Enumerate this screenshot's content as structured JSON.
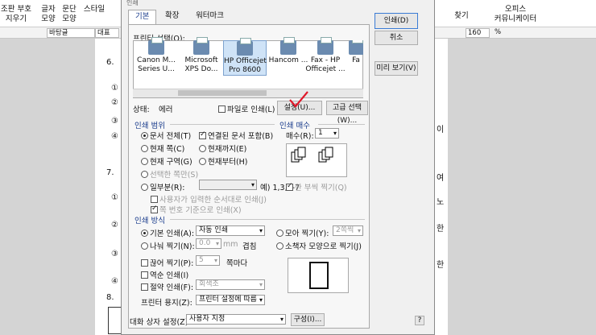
{
  "ribbon": {
    "items": [
      {
        "label": "조판 부호\n지우기"
      },
      {
        "label": "글자\n모양"
      },
      {
        "label": "문단\n모양"
      },
      {
        "label": "스타일"
      },
      {
        "label": "찾기"
      },
      {
        "label": "오피스\n커뮤니케이터"
      }
    ]
  },
  "toolbar": {
    "style_value": "바탕글",
    "font_value": "대표",
    "zoom_value": "160",
    "zoom_unit": "%"
  },
  "document": {
    "lines": [
      "6.",
      "①",
      "②",
      "③",
      "④",
      "7.",
      "①",
      "②",
      "③",
      "④",
      "8.",
      "이",
      "여",
      "노",
      "한",
      "한"
    ]
  },
  "dialog": {
    "title": "인쇄",
    "tabs": [
      "기본",
      "확장",
      "워터마크"
    ],
    "printer_select_label": "프린터 선택(O):",
    "printers": [
      "Canon M...\nSeries U...",
      "Microsoft\nXPS Do...",
      "HP Officejet\nPro 8600",
      "Hancom ...",
      "Fax - HP\nOfficejet ...",
      "Fa"
    ],
    "status_label": "상태:",
    "status_value": "에러",
    "print_to_file": "파일로 인쇄(L)",
    "settings_button": "설정(U)...",
    "advanced_button": "고급 선택(W)...",
    "print_button": "인쇄(D)",
    "cancel_button": "취소",
    "preview_button": "미리 보기(V)",
    "range": {
      "title": "인쇄 범위",
      "all": "문서 전체(T)",
      "linked": "연결된 문서 포함(B)",
      "current_page": "현재 쪽(C)",
      "to_current": "현재까지(E)",
      "current_section": "현재 구역(G)",
      "from_current": "현재부터(H)",
      "selection": "선택한 쪽만(S)",
      "pages": "일부분(R):",
      "pages_example": "예) 1,3,5-7",
      "user_order": "사용자가 입력한 순서대로 인쇄(J)",
      "page_number_basis": "쪽 번호 기준으로 인쇄(X)"
    },
    "copies": {
      "title": "인쇄 매수",
      "label": "매수(R):",
      "value": "1",
      "collate": "한 부씩 찍기(Q)"
    },
    "method": {
      "title": "인쇄 방식",
      "default": "기본 인쇄(A):",
      "default_value": "자동 인쇄",
      "split": "나눠 찍기(N):",
      "split_value": "0.0",
      "split_unit": "mm",
      "split_suffix": "겹침",
      "multi": "모아 찍기(Y):",
      "multi_value": "2쪽씩",
      "booklet": "소책자 모양으로 찍기(J)",
      "skip": "끊어 찍기(P):",
      "skip_value": "5",
      "skip_suffix": "쪽마다",
      "reverse": "역순 인쇄(I)",
      "save": "절약 인쇄(F):",
      "save_value": "회색조",
      "paper_label": "프린터 용지(Z):",
      "paper_value": "프린터 설정에 따름"
    },
    "dialog_settings_label": "대화 상자 설정(Z):",
    "dialog_settings_value": "사용자 지정",
    "compose_button": "구성(I)...",
    "help_button": "?"
  },
  "colors": {
    "annotation": "#e0182a",
    "section": "#1a3c8c",
    "selected_printer": "#cfe3f7"
  }
}
